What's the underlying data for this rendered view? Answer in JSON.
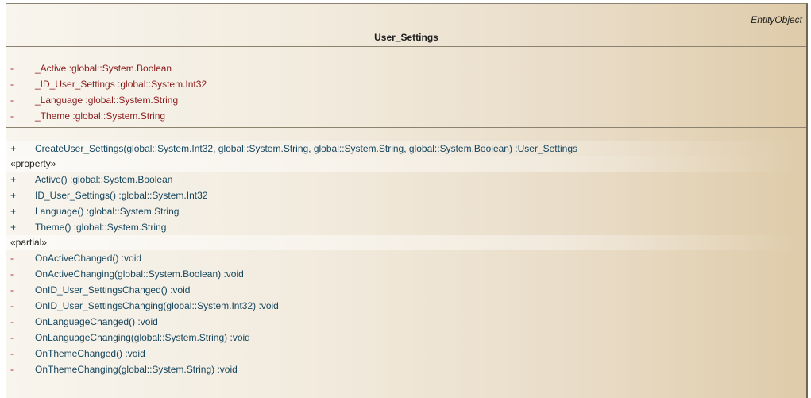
{
  "class": {
    "stereotype": "EntityObject",
    "name": "User_Settings"
  },
  "attributes": [
    {
      "visibility": "-",
      "text": "_Active  :global::System.Boolean"
    },
    {
      "visibility": "-",
      "text": "_ID_User_Settings :global::System.Int32"
    },
    {
      "visibility": "-",
      "text": "_Language  :global::System.String"
    },
    {
      "visibility": "-",
      "text": "_Theme  :global::System.String"
    }
  ],
  "operations": {
    "create": {
      "visibility": "+",
      "text": "CreateUser_Settings(global::System.Int32, global::System.String, global::System.String, global::System.Boolean)  :User_Settings"
    },
    "property_group": "«property»",
    "properties": [
      {
        "visibility": "+",
        "text": "Active()  :global::System.Boolean"
      },
      {
        "visibility": "+",
        "text": "ID_User_Settings()  :global::System.Int32"
      },
      {
        "visibility": "+",
        "text": "Language()  :global::System.String"
      },
      {
        "visibility": "+",
        "text": "Theme()  :global::System.String"
      }
    ],
    "partial_group": "«partial»",
    "partials": [
      {
        "visibility": "-",
        "text": "OnActiveChanged()  :void"
      },
      {
        "visibility": "-",
        "text": "OnActiveChanging(global::System.Boolean)  :void"
      },
      {
        "visibility": "-",
        "text": "OnID_User_SettingsChanged()  :void"
      },
      {
        "visibility": "-",
        "text": "OnID_User_SettingsChanging(global::System.Int32)  :void"
      },
      {
        "visibility": "-",
        "text": "OnLanguageChanged()  :void"
      },
      {
        "visibility": "-",
        "text": "OnLanguageChanging(global::System.String)  :void"
      },
      {
        "visibility": "-",
        "text": "OnThemeChanged()  :void"
      },
      {
        "visibility": "-",
        "text": "OnThemeChanging(global::System.String)  :void"
      }
    ]
  }
}
